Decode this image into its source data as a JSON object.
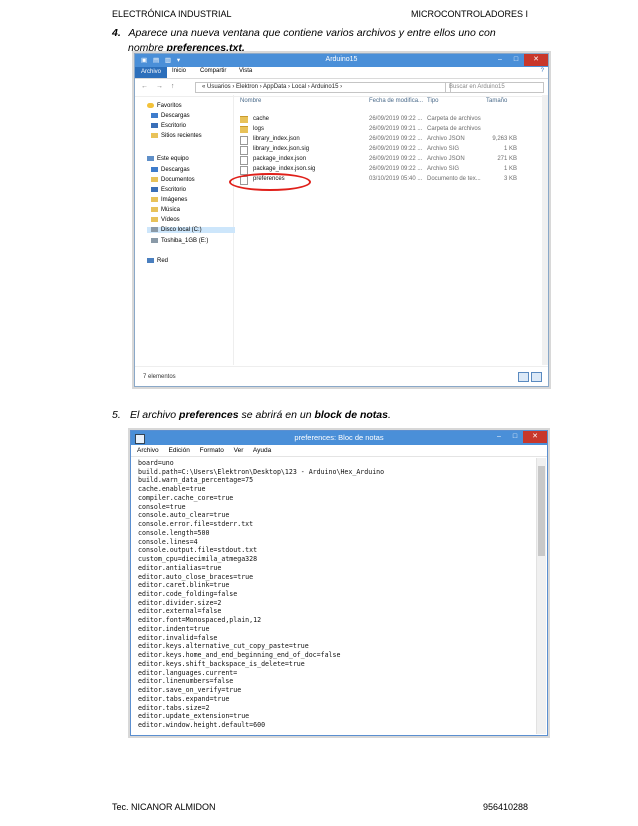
{
  "header": {
    "left": "ELECTRÓNICA INDUSTRIAL",
    "right": "MICROCONTROLADORES I"
  },
  "step4": {
    "num": "4.",
    "text": "Aparece una nueva ventana que contiene varios archivos y entre ellos uno con",
    "line2_pre": "nombre ",
    "line2_bold": "preferences.txt."
  },
  "step5": {
    "num": "5.",
    "pre": "El archivo ",
    "bold1": "preferences",
    "mid": " se abrirá en un ",
    "bold2": "block de notas",
    "post": "."
  },
  "explorer": {
    "title": "Arduino15",
    "quick_access": "▣ ▤ ▥ ▾",
    "ribbon_tabs": [
      "Archivo",
      "Inicio",
      "Compartir",
      "Vista"
    ],
    "help": "?",
    "nav": "← → ↑",
    "path": "«  Usuarios  ›  Elektron  ›  AppData  ›  Local  ›  Arduino15  ›",
    "search_placeholder": "Buscar en Arduino15",
    "columns": [
      "Nombre",
      "Fecha de modifica...",
      "Tipo",
      "Tamaño"
    ],
    "sidebar": [
      {
        "label": "Favoritos",
        "kind": "star"
      },
      {
        "label": "Descargas",
        "kind": "folder"
      },
      {
        "label": "Escritorio",
        "kind": "desk"
      },
      {
        "label": "Sitios recientes",
        "kind": "folder"
      },
      {
        "label": "Este equipo",
        "kind": "pc"
      },
      {
        "label": "Descargas",
        "kind": "folder"
      },
      {
        "label": "Documentos",
        "kind": "folder"
      },
      {
        "label": "Escritorio",
        "kind": "desk"
      },
      {
        "label": "Imágenes",
        "kind": "folder"
      },
      {
        "label": "Música",
        "kind": "folder"
      },
      {
        "label": "Vídeos",
        "kind": "folder"
      },
      {
        "label": "Disco local (C:)",
        "kind": "drive"
      },
      {
        "label": "Toshiba_1GB (E:)",
        "kind": "drive"
      },
      {
        "label": "Red",
        "kind": "net"
      }
    ],
    "files": [
      {
        "name": "cache",
        "date": "26/09/2019 09:22 ...",
        "type": "Carpeta de archivos",
        "size": "",
        "kind": "folder"
      },
      {
        "name": "logs",
        "date": "26/09/2019 09:21 ...",
        "type": "Carpeta de archivos",
        "size": "",
        "kind": "folder"
      },
      {
        "name": "library_index.json",
        "date": "26/09/2019 09:22 ...",
        "type": "Archivo JSON",
        "size": "9,263 KB",
        "kind": "doc"
      },
      {
        "name": "library_index.json.sig",
        "date": "26/09/2019 09:22 ...",
        "type": "Archivo SIG",
        "size": "1 KB",
        "kind": "doc"
      },
      {
        "name": "package_index.json",
        "date": "26/09/2019 09:22 ...",
        "type": "Archivo JSON",
        "size": "271 KB",
        "kind": "doc"
      },
      {
        "name": "package_index.json.sig",
        "date": "26/09/2019 09:22 ...",
        "type": "Archivo SIG",
        "size": "1 KB",
        "kind": "doc"
      },
      {
        "name": "preferences",
        "date": "03/10/2019 05:40 ...",
        "type": "Documento de tex...",
        "size": "3 KB",
        "kind": "doc"
      }
    ],
    "status": "7 elementos"
  },
  "notepad": {
    "title": "preferences: Bloc de notas",
    "menu": [
      "Archivo",
      "Edición",
      "Formato",
      "Ver",
      "Ayuda"
    ],
    "lines": [
      "board=uno",
      "build.path=C:\\Users\\Elektron\\Desktop\\123 - Arduino\\Hex_Arduino",
      "build.warn_data_percentage=75",
      "cache.enable=true",
      "compiler.cache_core=true",
      "console=true",
      "console.auto_clear=true",
      "console.error.file=stderr.txt",
      "console.length=500",
      "console.lines=4",
      "console.output.file=stdout.txt",
      "custom_cpu=diecimila_atmega328",
      "editor.antialias=true",
      "editor.auto_close_braces=true",
      "editor.caret.blink=true",
      "editor.code_folding=false",
      "editor.divider.size=2",
      "editor.external=false",
      "editor.font=Monospaced,plain,12",
      "editor.indent=true",
      "editor.invalid=false",
      "editor.keys.alternative_cut_copy_paste=true",
      "editor.keys.home_and_end_beginning_end_of_doc=false",
      "editor.keys.shift_backspace_is_delete=true",
      "editor.languages.current=",
      "editor.linenumbers=false",
      "editor.save_on_verify=true",
      "editor.tabs.expand=true",
      "editor.tabs.size=2",
      "editor.update_extension=true",
      "editor.window.height.default=600"
    ]
  },
  "footer": {
    "left": "Tec. NICANOR ALMIDON",
    "right": "956410288"
  }
}
